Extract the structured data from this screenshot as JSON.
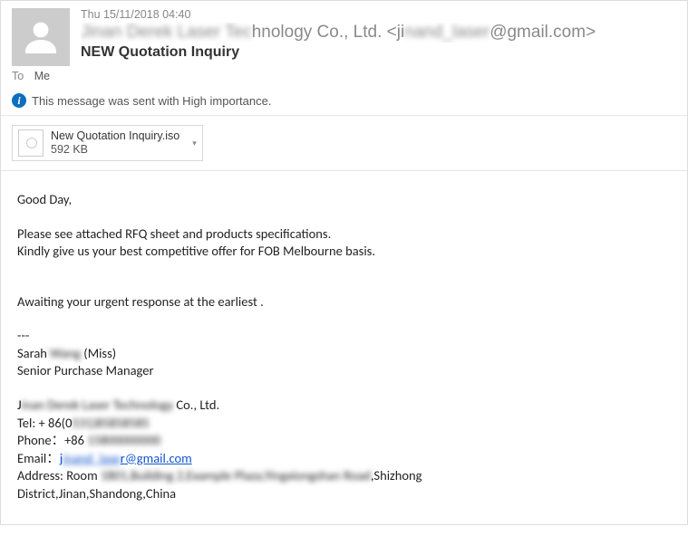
{
  "header": {
    "date": "Thu 15/11/2018 04:40",
    "from_name_prefix": "Jinan Derek Laser Tec",
    "from_name_suffix": "hnology Co., Ltd. <ji",
    "from_email_mid": "nand_laser",
    "from_email_end": "@gmail.com>",
    "subject": "NEW Quotation Inquiry",
    "to_label": "To",
    "to_value": "Me"
  },
  "importance": {
    "text": "This message was sent with High importance."
  },
  "attachment": {
    "name": "New Quotation Inquiry.iso",
    "size": "592 KB"
  },
  "body": {
    "greeting": "Good Day,",
    "p1_l1": "Please see attached RFQ sheet and products specifications.",
    "p1_l2": "Kindly give us your best competitive offer for FOB Melbourne basis.",
    "p2": "Awaiting  your urgent response at the earliest .",
    "sep": "---",
    "sig_name_pre": "Sarah ",
    "sig_name_blur": "Wang",
    "sig_name_post": " (Miss)",
    "sig_title": "Senior Purchase Manager",
    "company_pre": "J",
    "company_blur": "inan Derek Laser Technology",
    "company_post": " Co., Ltd.",
    "tel_pre": "Tel: + 86(0",
    "tel_blur": "531)85858585",
    "phone_pre": "Phone：+86 ",
    "phone_blur": "15800000000",
    "email_label": "Email：",
    "email_link_pre": "j",
    "email_link_blur": "inand_lase",
    "email_link_post": "r@gmail.com",
    "addr_pre": "Address: Room ",
    "addr_blur": "1801,Building 2,Example Plaza,Yingxiongshan Road",
    "addr_post": ",Shizhong",
    "addr_l2": "District,Jinan,Shandong,China"
  }
}
